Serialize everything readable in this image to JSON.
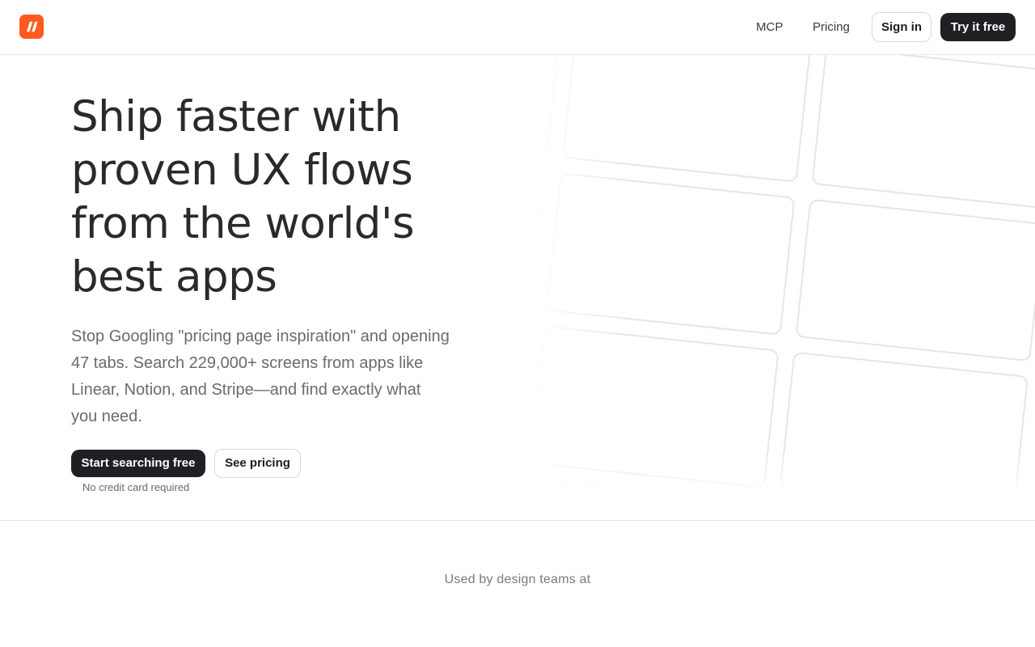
{
  "header": {
    "logo_name": "app-logo",
    "nav": {
      "mcp": "MCP",
      "pricing": "Pricing"
    },
    "sign_in": "Sign in",
    "try_free": "Try it free"
  },
  "hero": {
    "title_lines": [
      "Ship faster with",
      "proven UX flows",
      "from the world's",
      "best apps"
    ],
    "subtitle_lines": [
      "Stop Googling \"pricing page inspiration\" and opening",
      "47 tabs. Search 229,000+ screens from apps like",
      "Linear, Notion, and Stripe—and find exactly what",
      "you need."
    ],
    "primary_cta": "Start searching free",
    "secondary_cta": "See pricing",
    "note": "No credit card required"
  },
  "social_proof": {
    "label": "Used by design teams at"
  },
  "colors": {
    "brand": "#ff5a1f",
    "dark": "#1f1f24",
    "text_muted": "#6a6a70",
    "border": "#e8e8ea"
  }
}
